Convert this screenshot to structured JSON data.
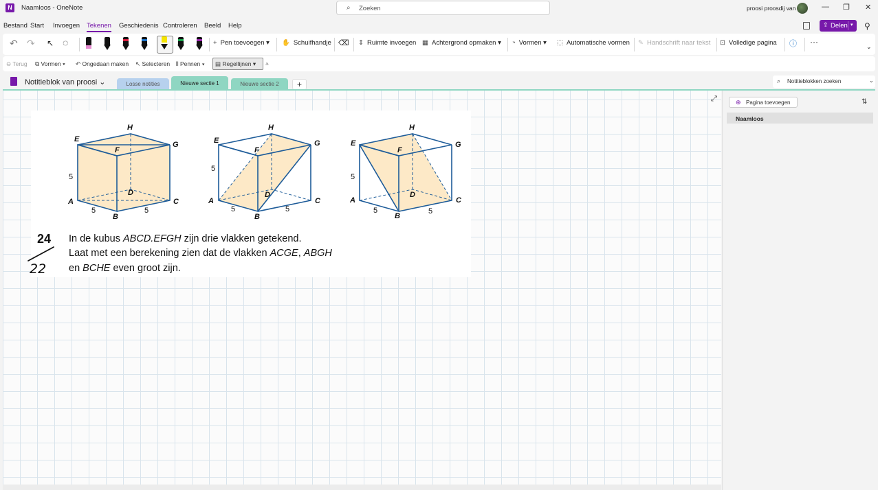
{
  "window": {
    "title": "Naamloos - OneNote",
    "search_placeholder": "Zoeken",
    "user_name": "proosi proosdij van",
    "controls": {
      "minimize": "—",
      "restore": "❐",
      "close": "✕"
    }
  },
  "menu": {
    "items": [
      "Bestand",
      "Start",
      "Invoegen",
      "Tekenen",
      "Geschiedenis",
      "Controleren",
      "Beeld",
      "Help"
    ],
    "active": "Tekenen",
    "share_label": "Delen"
  },
  "ribbon": {
    "pen_colors": [
      "#111111",
      "#111111",
      "#d81b3c",
      "#1a73c8",
      "#f5e400",
      "#17a34a",
      "#9b27b0"
    ],
    "add_pen": "Pen toevoegen",
    "hand": "Schuifhandje",
    "insert_space": "Ruimte invoegen",
    "background": "Achtergrond opmaken",
    "shapes": "Vormen",
    "auto_shapes": "Automatische vormen",
    "ink_to_text": "Handschrift naar tekst",
    "full_page": "Volledige pagina",
    "more": "···"
  },
  "subbar": {
    "back": "Terug",
    "shapes": "Vormen",
    "undo": "Ongedaan maken",
    "select": "Selecteren",
    "pens": "Pennen",
    "rule_lines": "Regellijnen"
  },
  "notebook": {
    "name": "Notitieblok van proosi",
    "sections": [
      "Losse notities",
      "Nieuwe sectie 1",
      "Nieuwe sectie 2"
    ],
    "active_section": "Nieuwe sectie 1",
    "add_section": "+",
    "search_placeholder": "Notitieblokken zoeken"
  },
  "page_panel": {
    "add_page": "Pagina toevoegen",
    "pages": [
      "Naamloos"
    ]
  },
  "content": {
    "exercise_number": "24",
    "handwritten_answer": "22",
    "cube_labels": {
      "E": "E",
      "F": "F",
      "G": "G",
      "H": "H",
      "A": "A",
      "B": "B",
      "C": "C",
      "D": "D",
      "edge": "5"
    },
    "line1_pre": "In de kubus ",
    "line1_it": "ABCD.EFGH",
    "line1_post": " zijn drie vlakken getekend.",
    "line2_pre": "Laat met een berekening zien dat de vlakken ",
    "line2_it1": "ACGE",
    "line2_sep": ", ",
    "line2_it2": "ABGH",
    "line3_pre": "en ",
    "line3_it": "BCHE",
    "line3_post": " even groot zijn."
  }
}
